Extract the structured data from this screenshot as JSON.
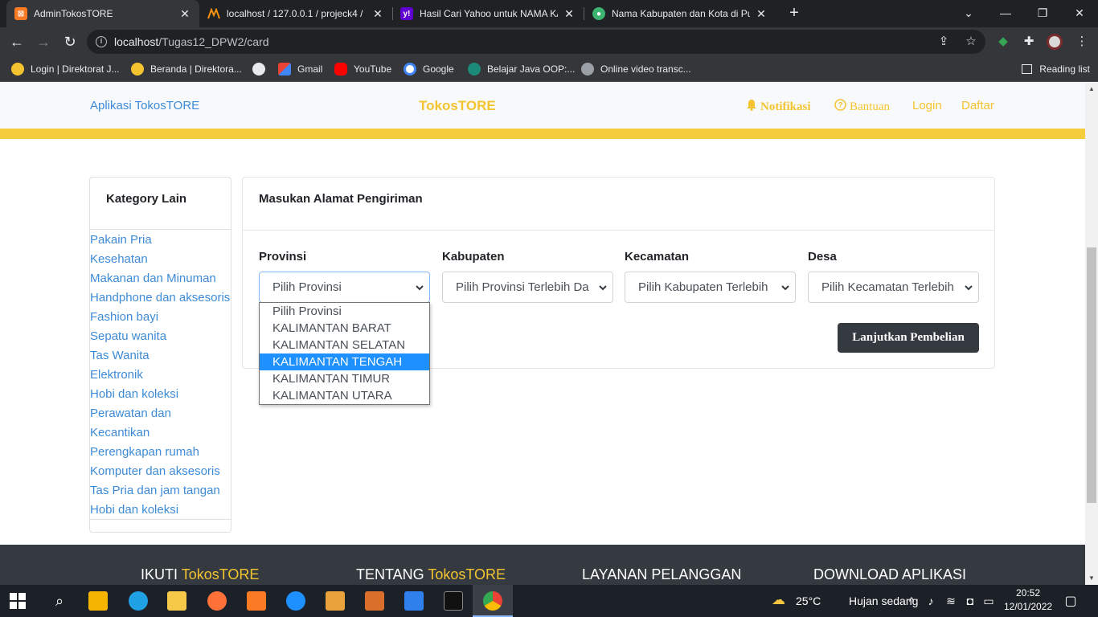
{
  "browser": {
    "tabs": [
      {
        "title": "AdminTokosTORE",
        "active": true
      },
      {
        "title": "localhost / 127.0.0.1 / projeck4 / "
      },
      {
        "title": "Hasil Cari Yahoo untuk NAMA KA"
      },
      {
        "title": "Nama Kabupaten dan Kota di Pul"
      }
    ],
    "url_host": "localhost",
    "url_path": "/Tugas12_DPW2/card",
    "bookmarks": [
      {
        "label": "Login | Direktorat J..."
      },
      {
        "label": "Beranda | Direktora..."
      },
      {
        "label": ""
      },
      {
        "label": "Gmail"
      },
      {
        "label": "YouTube"
      },
      {
        "label": "Google"
      },
      {
        "label": "Belajar Java OOP:..."
      },
      {
        "label": "Online video transc..."
      }
    ],
    "reading_list": "Reading list"
  },
  "site": {
    "brand": "Aplikasi TokosTORE",
    "center_brand": "TokosTORE",
    "nav": {
      "notifikasi": "Notifikasi",
      "bantuan": "Bantuan",
      "login": "Login",
      "daftar": "Daftar"
    },
    "accent_color": "#f4c430",
    "link_color": "#3d8bd8"
  },
  "sidebar": {
    "title": "Kategory Lain",
    "items": [
      "Pakain Pria",
      "Kesehatan",
      "Makanan dan Minuman",
      "Handphone dan aksesoris",
      "Fashion bayi",
      "Sepatu wanita",
      "Tas Wanita",
      "Elektronik",
      "Hobi dan koleksi",
      "Perawatan dan",
      "Kecantikan",
      "Perengkapan rumah",
      "Komputer dan aksesoris",
      "Tas Pria dan jam tangan",
      "Hobi dan koleksi"
    ]
  },
  "form": {
    "title": "Masukan Alamat Pengiriman",
    "fields": [
      {
        "label": "Provinsi",
        "value": "Pilih Provinsi"
      },
      {
        "label": "Kabupaten",
        "value": "Pilih Provinsi Terlebih Da"
      },
      {
        "label": "Kecamatan",
        "value": "Pilih Kabupaten Terlebih"
      },
      {
        "label": "Desa",
        "value": "Pilih Kecamatan Terlebih"
      }
    ],
    "submit_label": "Lanjutkan Pembelian",
    "province_options": [
      "Pilih Provinsi",
      "KALIMANTAN BARAT",
      "KALIMANTAN SELATAN",
      "KALIMANTAN TENGAH",
      "KALIMANTAN TIMUR",
      "KALIMANTAN UTARA"
    ],
    "highlighted_option": "KALIMANTAN TENGAH"
  },
  "footer": {
    "col1_prefix": "IKUTI ",
    "col1_brand": "TokosTORE",
    "col2_prefix": "TENTANG ",
    "col2_brand": "TokosTORE",
    "col3": "LAYANAN PELANGGAN",
    "col4": "DOWNLOAD APLIKASI"
  },
  "taskbar": {
    "weather_temp": "25°C",
    "weather_desc": "Hujan sedang",
    "time": "20:52",
    "date": "12/01/2022"
  }
}
